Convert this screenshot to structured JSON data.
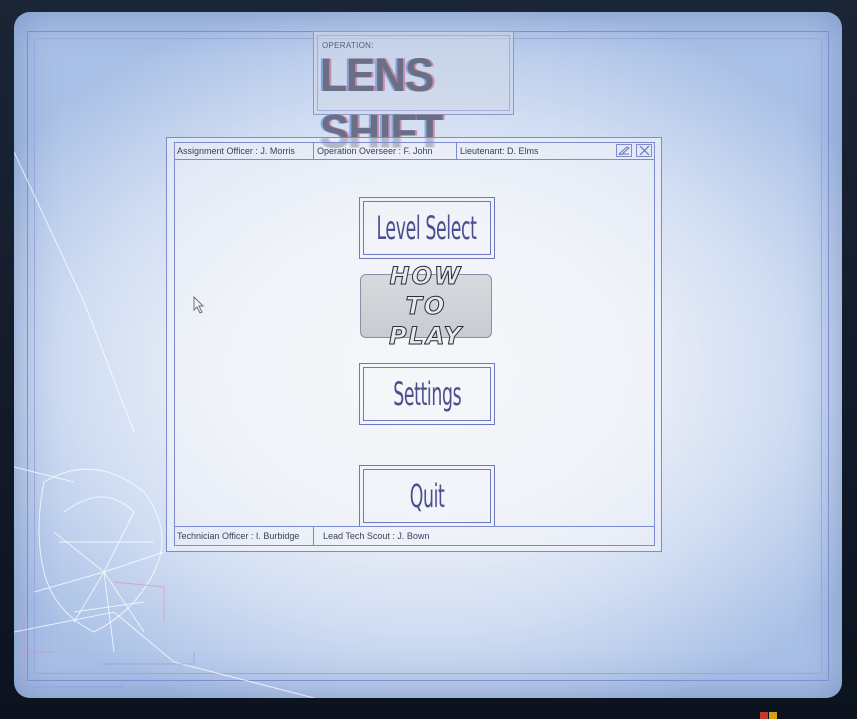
{
  "title": {
    "prefix": "OPERATION:",
    "name": "LENS SHIFT"
  },
  "header": {
    "assignment_officer": "Assignment Officer : J. Morris",
    "operation_overseer": "Operation Overseer : F. John",
    "lieutenant": "Lieutenant: D. Elms",
    "icons": [
      "edit-icon",
      "close-icon"
    ]
  },
  "menu": {
    "level_select": "Level Select",
    "how_to_play": "HOW TO PLAY",
    "settings": "Settings",
    "quit": "Quit"
  },
  "footer": {
    "technician_officer": "Technician Officer : I. Burbidge",
    "lead_tech_scout": "Lead Tech Scout : J. Bown"
  },
  "colors": {
    "frame_line": "#7e8ad0",
    "button_text": "#4c4f8e",
    "screen_edge": "#a9c0e6",
    "screen_center": "#f6f7fb"
  }
}
